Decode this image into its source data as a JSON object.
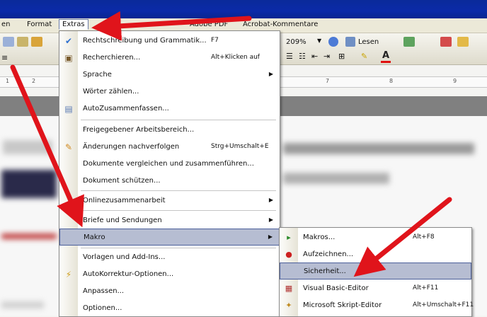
{
  "colors": {
    "title_bar": "#0b2aa8",
    "menu_highlight": "#b6bdd2",
    "menu_highlight_border": "#4b5f9a",
    "annotation_arrow": "#e0141b"
  },
  "menubar": {
    "items": [
      "en",
      "Format",
      "Extras",
      "Adobe PDF",
      "Acrobat-Kommentare"
    ],
    "active": "Extras"
  },
  "toolbar": {
    "zoom": "209%",
    "read_label": "Lesen"
  },
  "ruler": {
    "ticks": [
      "1",
      "2",
      "7",
      "8",
      "9"
    ]
  },
  "extras_menu": {
    "items": [
      {
        "label": "Rechtschreibung und Grammatik...",
        "shortcut": "F7",
        "icon": "spellcheck-icon"
      },
      {
        "label": "Recherchieren...",
        "shortcut": "Alt+Klicken auf",
        "icon": "research-icon"
      },
      {
        "label": "Sprache",
        "submenu": true
      },
      {
        "label": "Wörter zählen..."
      },
      {
        "label": "AutoZusammenfassen...",
        "icon": "autosummary-icon"
      },
      {
        "label": "Freigegebener Arbeitsbereich..."
      },
      {
        "label": "Änderungen nachverfolgen",
        "shortcut": "Strg+Umschalt+E",
        "icon": "track-changes-icon"
      },
      {
        "label": "Dokumente vergleichen und zusammenführen..."
      },
      {
        "label": "Dokument schützen..."
      },
      {
        "label": "Onlinezusammenarbeit",
        "submenu": true
      },
      {
        "label": "Briefe und Sendungen",
        "submenu": true
      },
      {
        "label": "Makro",
        "submenu": true,
        "highlighted": true
      },
      {
        "label": "Vorlagen und Add-Ins..."
      },
      {
        "label": "AutoKorrektur-Optionen...",
        "icon": "autocorrect-icon"
      },
      {
        "label": "Anpassen..."
      },
      {
        "label": "Optionen..."
      }
    ]
  },
  "makro_submenu": {
    "items": [
      {
        "label": "Makros...",
        "shortcut": "Alt+F8",
        "icon": "play-macro-icon"
      },
      {
        "label": "Aufzeichnen...",
        "icon": "record-icon"
      },
      {
        "label": "Sicherheit...",
        "highlighted": true
      },
      {
        "label": "Visual Basic-Editor",
        "shortcut": "Alt+F11",
        "icon": "vba-editor-icon"
      },
      {
        "label": "Microsoft Skript-Editor",
        "shortcut": "Alt+Umschalt+F11",
        "icon": "script-editor-icon"
      }
    ]
  }
}
